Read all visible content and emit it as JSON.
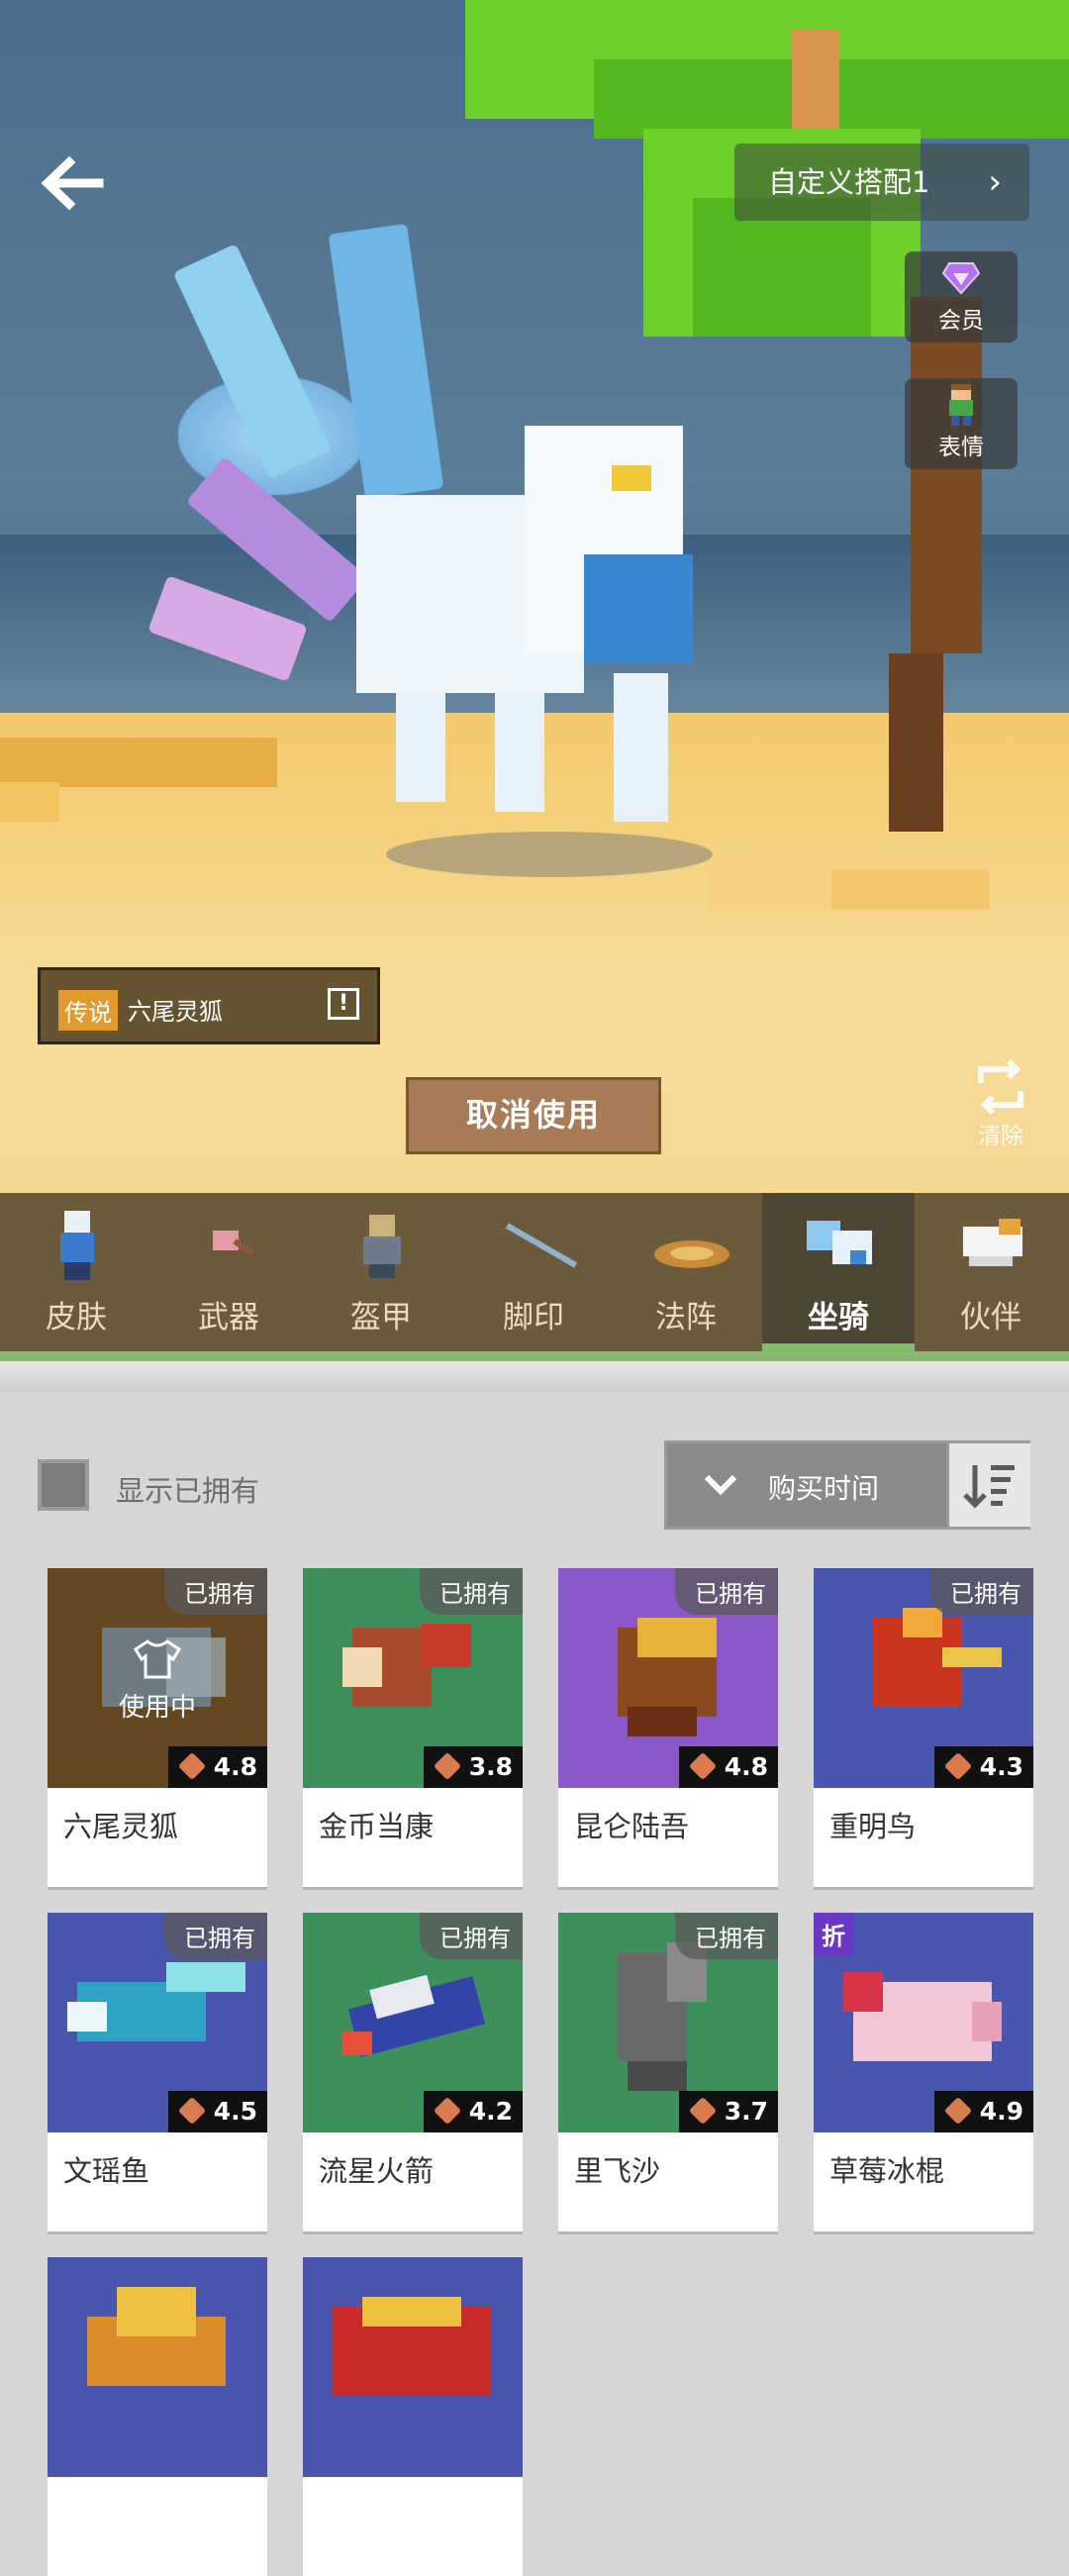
{
  "header": {
    "back_icon": "back-arrow-icon",
    "outfit_label": "自定义搭配1",
    "outfit_chevron": "›"
  },
  "side_buttons": [
    {
      "icon": "diamond-icon",
      "label": "会员"
    },
    {
      "icon": "emote-icon",
      "label": "表情"
    }
  ],
  "selected": {
    "rarity": "传说",
    "name": "六尾灵狐",
    "info_icon": "!"
  },
  "actions": {
    "cancel_label": "取消使用",
    "clear_label": "清除"
  },
  "tabs": [
    {
      "label": "皮肤",
      "active": false
    },
    {
      "label": "武器",
      "active": false
    },
    {
      "label": "盔甲",
      "active": false
    },
    {
      "label": "脚印",
      "active": false
    },
    {
      "label": "法阵",
      "active": false
    },
    {
      "label": "坐骑",
      "active": true
    },
    {
      "label": "伙伴",
      "active": false
    }
  ],
  "filter": {
    "show_owned_label": "显示已拥有",
    "show_owned_checked": false,
    "sort_label": "购买时间",
    "sort_chevron": "❯"
  },
  "items": [
    {
      "name": "六尾灵狐",
      "badge": "已拥有",
      "rating": "4.8",
      "status": "使用中",
      "bg": "#7a5527"
    },
    {
      "name": "金币当康",
      "badge": "已拥有",
      "rating": "3.8",
      "bg": "#3d8f5b"
    },
    {
      "name": "昆仑陆吾",
      "badge": "已拥有",
      "rating": "4.8",
      "bg": "#8a58c9"
    },
    {
      "name": "重明鸟",
      "badge": "已拥有",
      "rating": "4.3",
      "bg": "#4a55ae"
    },
    {
      "name": "文瑶鱼",
      "badge": "已拥有",
      "rating": "4.5",
      "bg": "#4a55ae"
    },
    {
      "name": "流星火箭",
      "badge": "已拥有",
      "rating": "4.2",
      "bg": "#3d8f5b"
    },
    {
      "name": "里飞沙",
      "badge": "已拥有",
      "rating": "3.7",
      "bg": "#3d8f5b"
    },
    {
      "name": "草莓冰棍",
      "badge": "折",
      "rating": "4.9",
      "bg": "#4a55ae"
    },
    {
      "bg": "#4a55ae"
    },
    {
      "bg": "#4a55ae"
    }
  ]
}
